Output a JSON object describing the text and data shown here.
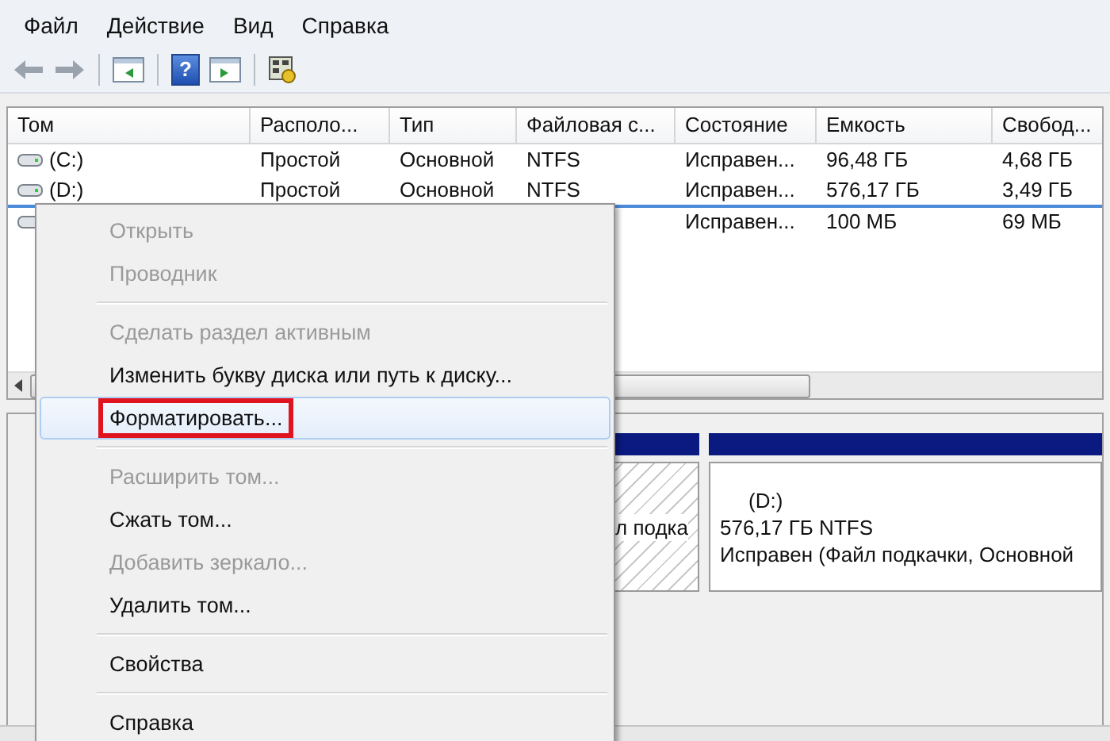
{
  "menu_bar": [
    "Файл",
    "Действие",
    "Вид",
    "Справка"
  ],
  "toolbar": [
    {
      "kind": "back",
      "disabled": true
    },
    {
      "kind": "forward",
      "disabled": true
    },
    {
      "kind": "separator"
    },
    {
      "kind": "pane-left"
    },
    {
      "kind": "separator"
    },
    {
      "kind": "help",
      "glyph": "?"
    },
    {
      "kind": "pane-right"
    },
    {
      "kind": "separator"
    },
    {
      "kind": "settings"
    }
  ],
  "table": {
    "columns": [
      "Том",
      "Располо...",
      "Тип",
      "Файловая с...",
      "Состояние",
      "Емкость",
      "Свобод..."
    ],
    "rows": [
      {
        "selected": false,
        "cells": [
          "(C:)",
          "Простой",
          "Основной",
          "NTFS",
          "Исправен...",
          "96,48 ГБ",
          "4,68 ГБ"
        ]
      },
      {
        "selected": false,
        "cells": [
          "(D:)",
          "Простой",
          "Основной",
          "NTFS",
          "Исправен...",
          "576,17 ГБ",
          "3,49 ГБ"
        ]
      },
      {
        "selected": true,
        "cells": [
          "",
          "",
          "",
          "",
          "Исправен...",
          "100 МБ",
          "69 МБ"
        ]
      }
    ]
  },
  "disk_map": {
    "partitions": [
      {
        "kind": "hatched",
        "lines": [
          "л подка"
        ]
      },
      {
        "kind": "plain",
        "lines": [
          "(D:)",
          "576,17 ГБ NTFS",
          "Исправен (Файл подкачки, Основной"
        ]
      }
    ]
  },
  "context_menu": [
    {
      "kind": "item",
      "label": "Открыть",
      "disabled": true,
      "selected": false,
      "outlined": false
    },
    {
      "kind": "item",
      "label": "Проводник",
      "disabled": true,
      "selected": false,
      "outlined": false
    },
    {
      "kind": "separator"
    },
    {
      "kind": "item",
      "label": "Сделать раздел активным",
      "disabled": true,
      "selected": false,
      "outlined": false
    },
    {
      "kind": "item",
      "label": "Изменить букву диска или путь к диску...",
      "disabled": false,
      "selected": false,
      "outlined": false
    },
    {
      "kind": "item",
      "label": "Форматировать...",
      "disabled": false,
      "selected": true,
      "outlined": true
    },
    {
      "kind": "separator"
    },
    {
      "kind": "item",
      "label": "Расширить том...",
      "disabled": true,
      "selected": false,
      "outlined": false
    },
    {
      "kind": "item",
      "label": "Сжать том...",
      "disabled": false,
      "selected": false,
      "outlined": false
    },
    {
      "kind": "item",
      "label": "Добавить зеркало...",
      "disabled": true,
      "selected": false,
      "outlined": false
    },
    {
      "kind": "item",
      "label": "Удалить том...",
      "disabled": false,
      "selected": false,
      "outlined": false
    },
    {
      "kind": "separator"
    },
    {
      "kind": "item",
      "label": "Свойства",
      "disabled": false,
      "selected": false,
      "outlined": false
    },
    {
      "kind": "separator"
    },
    {
      "kind": "item",
      "label": "Справка",
      "disabled": false,
      "selected": false,
      "outlined": false
    }
  ]
}
